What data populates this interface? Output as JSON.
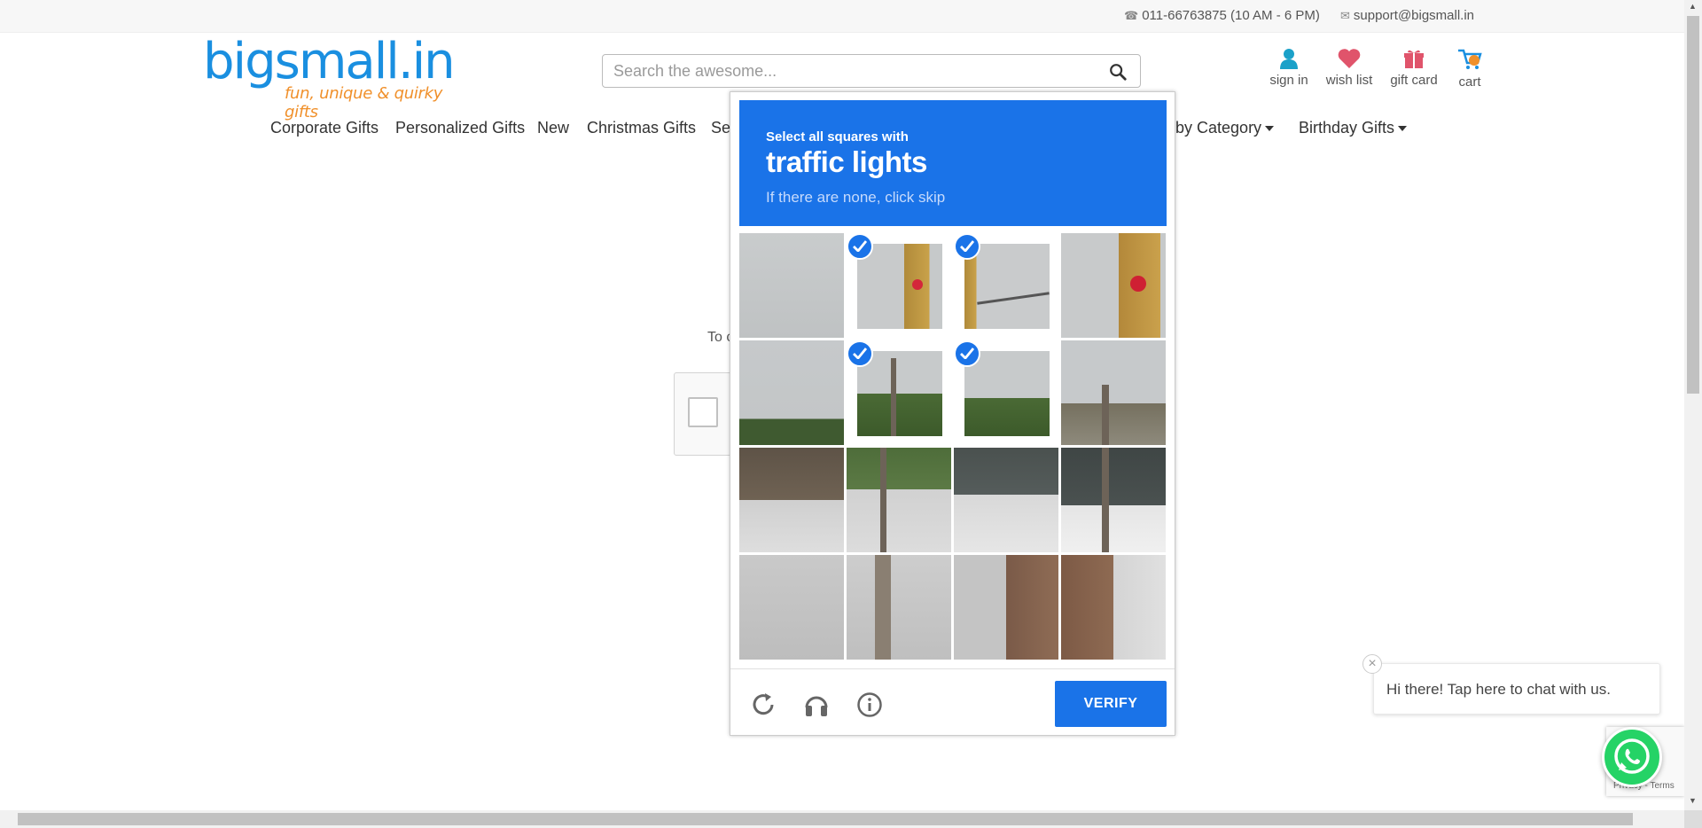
{
  "topbar": {
    "phone": "011-66763875 (10 AM - 6 PM)",
    "email": "support@bigsmall.in"
  },
  "header": {
    "logo_text": "bigsmall.in",
    "logo_tagline": "fun, unique & quirky gifts",
    "search_placeholder": "Search the awesome...",
    "icons": [
      {
        "label": "sign in",
        "icon": "user-icon"
      },
      {
        "label": "wish list",
        "icon": "heart-icon"
      },
      {
        "label": "gift card",
        "icon": "gift-icon"
      },
      {
        "label": "cart",
        "icon": "cart-icon"
      }
    ]
  },
  "nav": {
    "items": [
      "Corporate Gifts",
      "Personalized Gifts",
      "New",
      "Christmas Gifts",
      "Sec",
      "p by Category",
      "Birthday Gifts"
    ]
  },
  "background": {
    "partial_text": "To c"
  },
  "captcha": {
    "instruction_line1": "Select all squares with",
    "instruction_target": "traffic lights",
    "instruction_line3": "If there are none, click skip",
    "verify_label": "VERIFY",
    "tiles": [
      {
        "row": 1,
        "col": 1,
        "selected": false
      },
      {
        "row": 1,
        "col": 2,
        "selected": true
      },
      {
        "row": 1,
        "col": 3,
        "selected": true
      },
      {
        "row": 1,
        "col": 4,
        "selected": false
      },
      {
        "row": 2,
        "col": 1,
        "selected": false
      },
      {
        "row": 2,
        "col": 2,
        "selected": true
      },
      {
        "row": 2,
        "col": 3,
        "selected": true
      },
      {
        "row": 2,
        "col": 4,
        "selected": false
      },
      {
        "row": 3,
        "col": 1,
        "selected": false
      },
      {
        "row": 3,
        "col": 2,
        "selected": false
      },
      {
        "row": 3,
        "col": 3,
        "selected": false
      },
      {
        "row": 3,
        "col": 4,
        "selected": false
      },
      {
        "row": 4,
        "col": 1,
        "selected": false
      },
      {
        "row": 4,
        "col": 2,
        "selected": false
      },
      {
        "row": 4,
        "col": 3,
        "selected": false
      },
      {
        "row": 4,
        "col": 4,
        "selected": false
      }
    ],
    "footer_icons": [
      "reload-icon",
      "headphones-icon",
      "info-icon"
    ],
    "accent_color": "#1a73e8"
  },
  "chat": {
    "message": "Hi there! Tap here to chat with us.",
    "close_glyph": "×"
  },
  "recaptcha_badge": {
    "text": "Privacy - Terms"
  }
}
